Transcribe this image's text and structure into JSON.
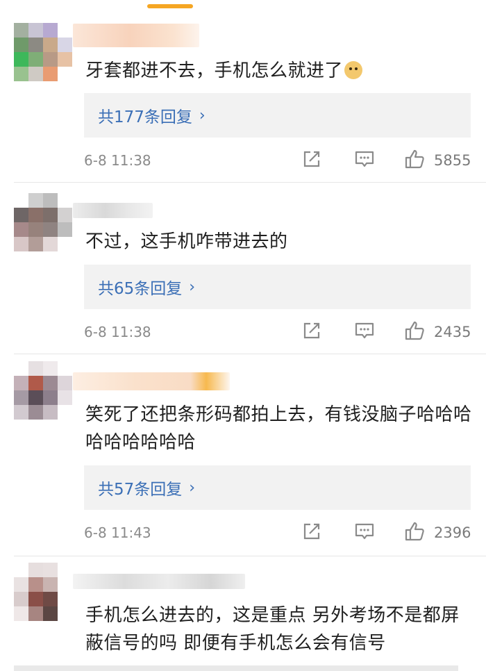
{
  "comments": [
    {
      "text": "牙套都进不去，手机怎么就进了",
      "emoji": "doge-emoji",
      "reply_label": "共177条回复",
      "time": "6-8 11:38",
      "likes": "5855"
    },
    {
      "text": "不过，这手机咋带进去的",
      "reply_label": "共65条回复",
      "time": "6-8 11:38",
      "likes": "2435"
    },
    {
      "text": "笑死了还把条形码都拍上去，有钱没脑子哈哈哈哈哈哈哈哈哈",
      "reply_label": "共57条回复",
      "time": "6-8 11:43",
      "likes": "2396"
    },
    {
      "text": "手机怎么进去的，这是重点 另外考场不是都屏蔽信号的吗 即便有手机怎么会有信号"
    }
  ],
  "icons": {
    "share": "share-icon",
    "comment": "comment-icon",
    "like": "thumbs-up-icon",
    "chevron": "chevron-right-icon"
  },
  "colors": {
    "accent_link": "#3b6fb6",
    "reply_bg": "#f2f2f2",
    "meta_text": "#8a8a8a",
    "top_indicator": "#f5a623"
  }
}
